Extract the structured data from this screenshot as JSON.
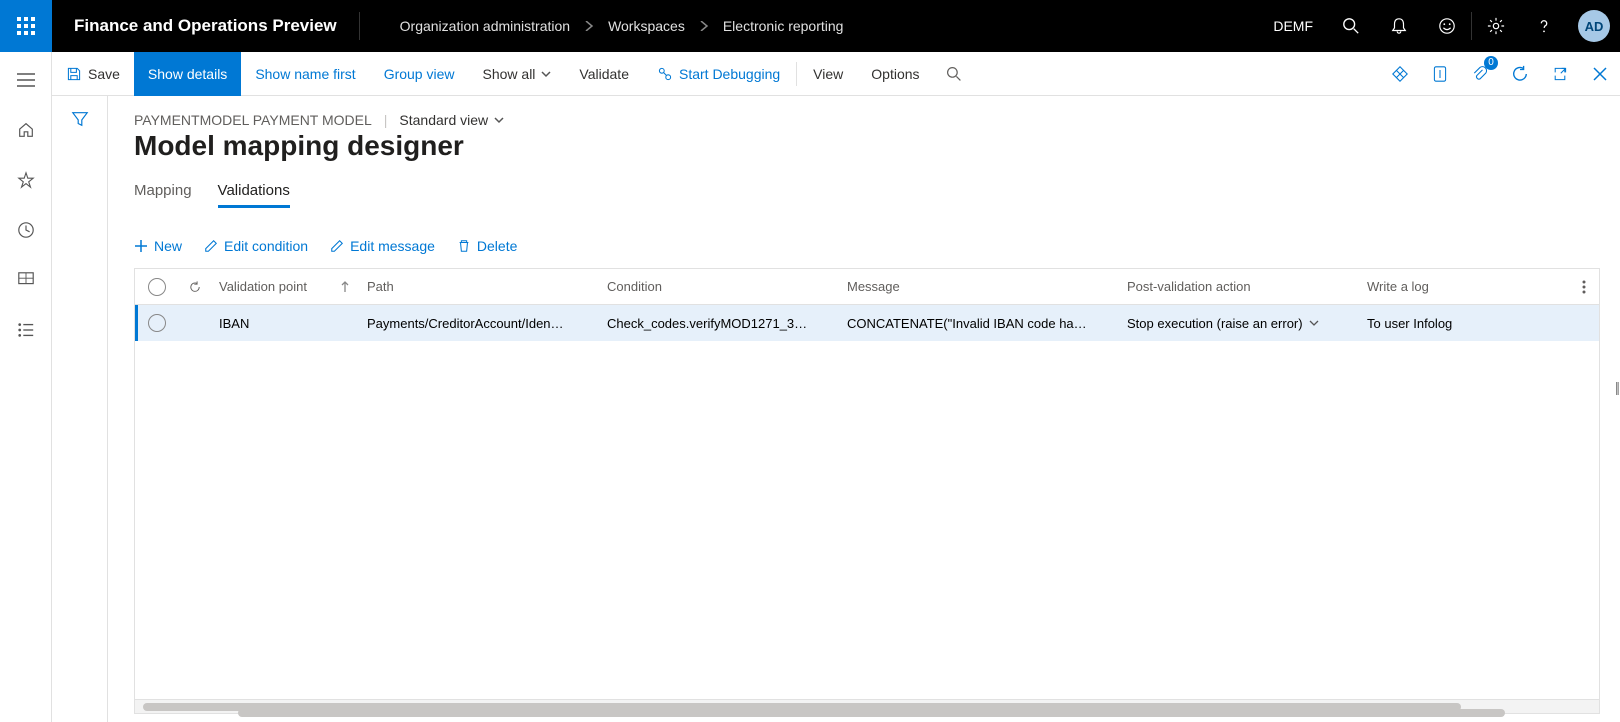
{
  "topbar": {
    "app_title": "Finance and Operations Preview",
    "breadcrumb": [
      "Organization administration",
      "Workspaces",
      "Electronic reporting"
    ],
    "company": "DEMF",
    "avatar": "AD",
    "notification_count": "0"
  },
  "actionbar": {
    "save": "Save",
    "show_details": "Show details",
    "show_name_first": "Show name first",
    "group_view": "Group view",
    "show_all": "Show all",
    "validate": "Validate",
    "start_debugging": "Start Debugging",
    "view": "View",
    "options": "Options"
  },
  "page": {
    "model_path": "PAYMENTMODEL PAYMENT MODEL",
    "view_label": "Standard view",
    "title": "Model mapping designer"
  },
  "tabs": {
    "mapping": "Mapping",
    "validations": "Validations",
    "active": "validations"
  },
  "tools": {
    "new": "New",
    "edit_condition": "Edit condition",
    "edit_message": "Edit message",
    "delete": "Delete"
  },
  "grid": {
    "columns": {
      "validation_point": "Validation point",
      "path": "Path",
      "condition": "Condition",
      "message": "Message",
      "post_validation_action": "Post-validation action",
      "write_a_log": "Write a log"
    },
    "rows": [
      {
        "validation_point": "IBAN",
        "path": "Payments/CreditorAccount/Iden…",
        "condition": "Check_codes.verifyMOD1271_3…",
        "message": "CONCATENATE(\"Invalid IBAN code ha…",
        "post_validation_action": "Stop execution (raise an error)",
        "write_a_log": "To user Infolog"
      }
    ]
  }
}
